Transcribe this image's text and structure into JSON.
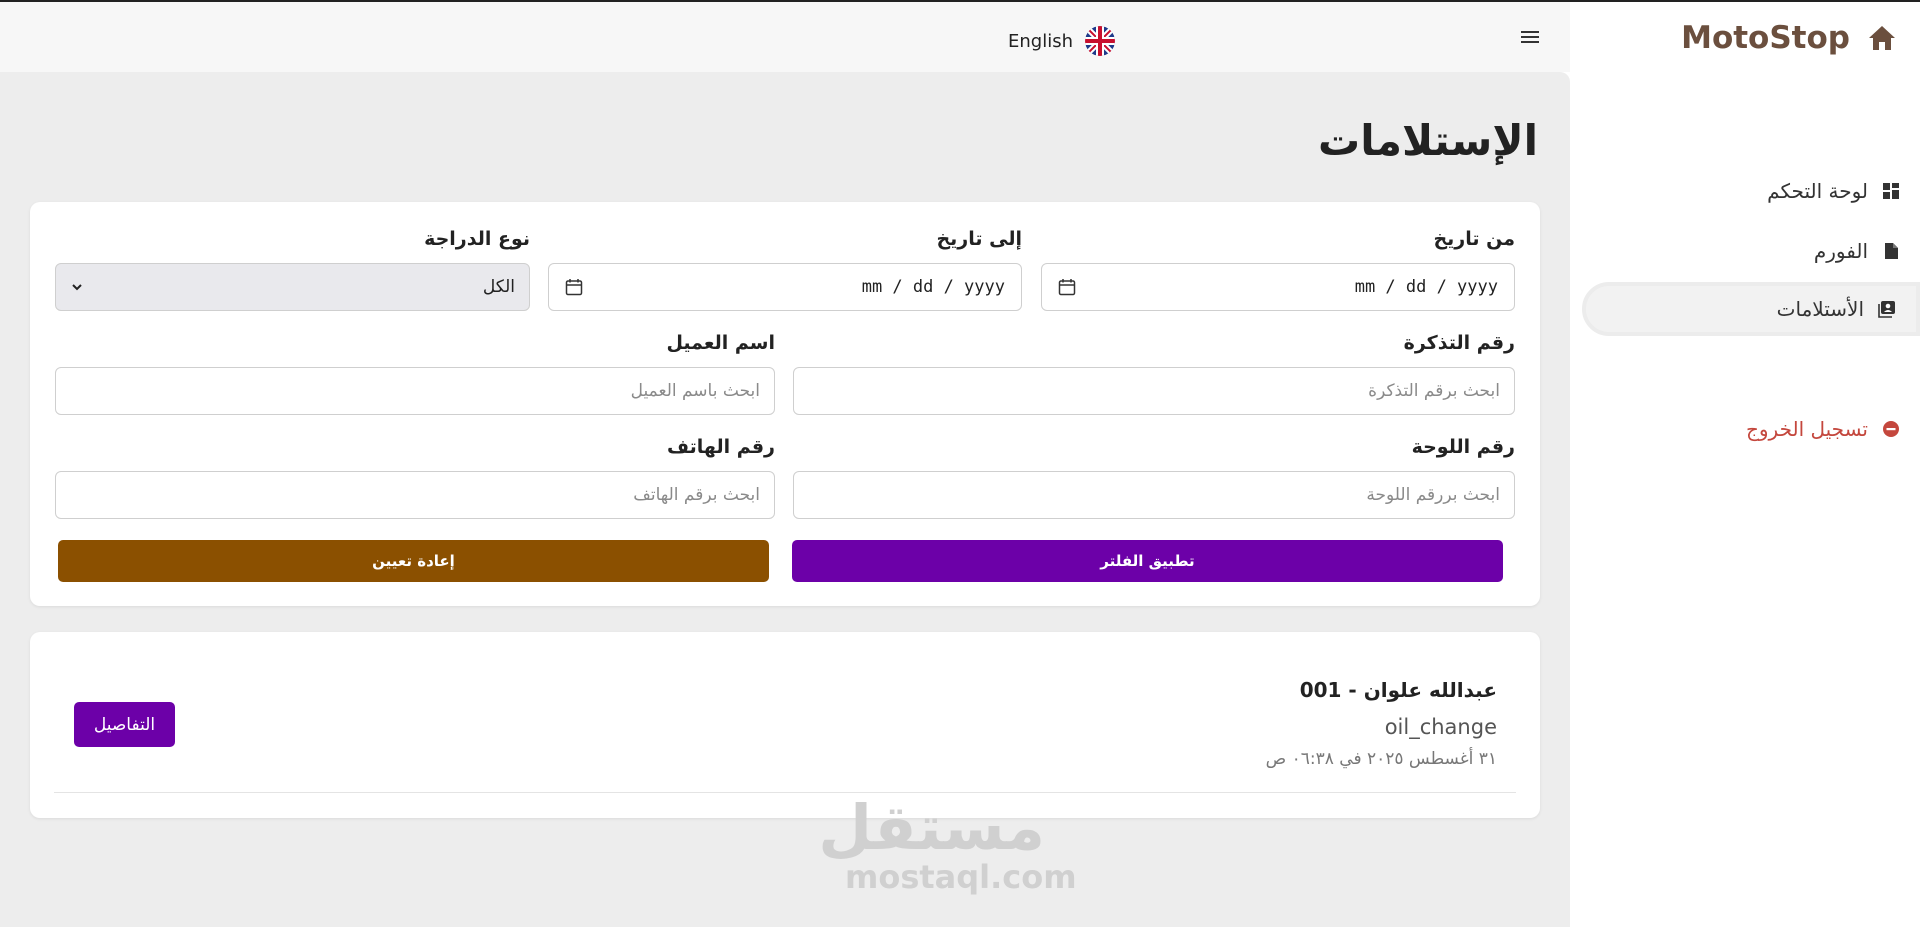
{
  "header": {
    "language_label": "English",
    "language_flag_icon": "uk-flag-icon",
    "menu_icon": "hamburger-icon"
  },
  "sidebar": {
    "brand": "MotoStop",
    "brand_icon": "home-icon",
    "items": [
      {
        "label": "لوحة التحكم",
        "icon": "dashboard-icon",
        "active": false
      },
      {
        "label": "الفورم",
        "icon": "document-icon",
        "active": false
      },
      {
        "label": "الأستلامات",
        "icon": "receipts-icon",
        "active": true
      }
    ],
    "logout_label": "تسجيل الخروج",
    "logout_icon": "logout-icon"
  },
  "page": {
    "title": "الإستلامات"
  },
  "filters": {
    "from_date": {
      "label": "من تاريخ",
      "value": "mm / dd / yyyy"
    },
    "to_date": {
      "label": "إلى تاريخ",
      "value": "mm / dd / yyyy"
    },
    "bike_type": {
      "label": "نوع الدراجة",
      "value": "الكل"
    },
    "ticket_number": {
      "label": "رقم التذكرة",
      "placeholder": "ابحث برقم التذكرة"
    },
    "customer_name": {
      "label": "اسم العميل",
      "placeholder": "ابحث باسم العميل"
    },
    "plate_number": {
      "label": "رقم اللوحة",
      "placeholder": "ابحث بررقم اللوحة"
    },
    "phone_number": {
      "label": "رقم الهاتف",
      "placeholder": "ابحث برقم الهاتف"
    },
    "apply_label": "تطبيق الفلتر",
    "reset_label": "إعادة تعيين"
  },
  "results": [
    {
      "title": "عبدالله علوان - 001",
      "service": "oil_change",
      "date": "٣١ أغسطس ٢٠٢٥ في ٠٦:٣٨ ص",
      "details_label": "التفاصيل"
    }
  ],
  "colors": {
    "primary": "#6c00a8",
    "reset": "#8b5000",
    "brand": "#6b4f3e",
    "logout": "#c4473d"
  },
  "watermark": {
    "arabic": "مستقل",
    "latin": "mostaql.com"
  }
}
